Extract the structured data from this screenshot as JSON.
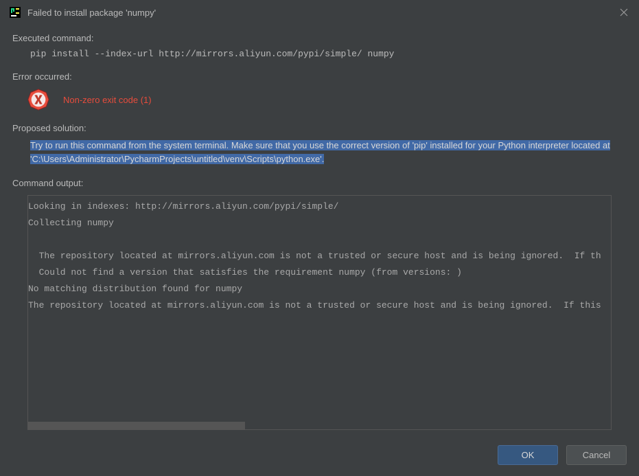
{
  "titlebar": {
    "title": "Failed to install package 'numpy'"
  },
  "labels": {
    "executed_command": "Executed command:",
    "error_occurred": "Error occurred:",
    "proposed_solution": "Proposed solution:",
    "command_output": "Command output:"
  },
  "executed_command": "pip install --index-url http://mirrors.aliyun.com/pypi/simple/ numpy",
  "error_text": "Non-zero exit code (1)",
  "solution_text": "Try to run this command from the system terminal. Make sure that you use the correct version of 'pip' installed for your Python interpreter located at 'C:\\Users\\Administrator\\PycharmProjects\\untitled\\venv\\Scripts\\python.exe'.",
  "command_output_lines": [
    "Looking in indexes: http://mirrors.aliyun.com/pypi/simple/",
    "Collecting numpy",
    "",
    "  The repository located at mirrors.aliyun.com is not a trusted or secure host and is being ignored.  If th",
    "  Could not find a version that satisfies the requirement numpy (from versions: )",
    "No matching distribution found for numpy",
    "The repository located at mirrors.aliyun.com is not a trusted or secure host and is being ignored.  If this"
  ],
  "buttons": {
    "ok": "OK",
    "cancel": "Cancel"
  }
}
